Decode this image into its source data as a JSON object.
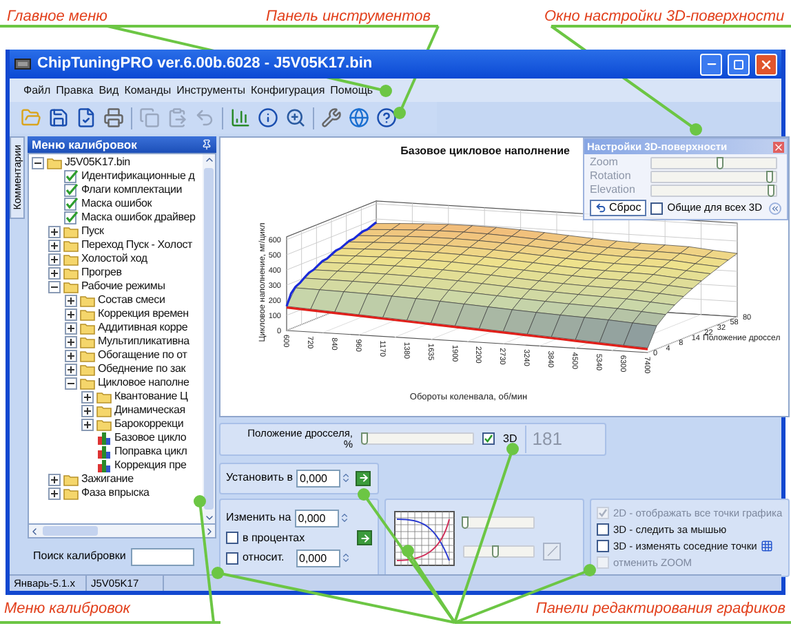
{
  "annotations": {
    "top": [
      {
        "text": "Главное меню"
      },
      {
        "text": "Панель инструментов"
      },
      {
        "text": "Окно настройки 3D-поверхности"
      }
    ],
    "bottom": [
      {
        "text": "Меню калибровок"
      },
      {
        "text": "Панели редактирования графиков"
      }
    ]
  },
  "window": {
    "title": "ChipTuningPRO ver.6.00b.6028 - J5V05K17.bin"
  },
  "menu": [
    "Файл",
    "Правка",
    "Вид",
    "Команды",
    "Инструменты",
    "Конфигурация",
    "Помощь"
  ],
  "side_tab": "Комментарии",
  "calibration_menu": {
    "title": "Меню калибровок",
    "tree": [
      {
        "label": "J5V05K17.bin",
        "kind": "folder",
        "expanded": true,
        "children": [
          {
            "label": "Идентификационные д",
            "kind": "check"
          },
          {
            "label": "Флаги комплектации",
            "kind": "check"
          },
          {
            "label": "Маска ошибок",
            "kind": "check"
          },
          {
            "label": "Маска ошибок драйвер",
            "kind": "check"
          },
          {
            "label": "Пуск",
            "kind": "folder",
            "expanded": false
          },
          {
            "label": "Переход Пуск - Холост",
            "kind": "folder",
            "expanded": false
          },
          {
            "label": "Холостой ход",
            "kind": "folder",
            "expanded": false
          },
          {
            "label": "Прогрев",
            "kind": "folder",
            "expanded": false
          },
          {
            "label": "Рабочие режимы",
            "kind": "folder",
            "expanded": true,
            "children": [
              {
                "label": "Состав смеси",
                "kind": "folder",
                "expanded": false
              },
              {
                "label": "Коррекция времен",
                "kind": "folder",
                "expanded": false
              },
              {
                "label": "Аддитивная корре",
                "kind": "folder",
                "expanded": false
              },
              {
                "label": "Мультипликативна",
                "kind": "folder",
                "expanded": false
              },
              {
                "label": "Обогащение по от",
                "kind": "folder",
                "expanded": false
              },
              {
                "label": "Обеднение по зак",
                "kind": "folder",
                "expanded": false
              },
              {
                "label": "Цикловое наполне",
                "kind": "folder",
                "expanded": true,
                "children": [
                  {
                    "label": "Квантование Ц",
                    "kind": "folder",
                    "expanded": false
                  },
                  {
                    "label": "Динамическая",
                    "kind": "folder",
                    "expanded": false
                  },
                  {
                    "label": "Барокоррекци",
                    "kind": "folder",
                    "expanded": false
                  },
                  {
                    "label": "Базовое цикло",
                    "kind": "chart"
                  },
                  {
                    "label": "Поправка цикл",
                    "kind": "chart"
                  },
                  {
                    "label": "Коррекция пре",
                    "kind": "chart"
                  }
                ]
              }
            ]
          },
          {
            "label": "Зажигание",
            "kind": "folder",
            "expanded": false
          },
          {
            "label": "Фаза впрыска",
            "kind": "folder",
            "expanded": false
          }
        ]
      }
    ],
    "search_label": "Поиск калибровки"
  },
  "chart": {
    "title": "Базовое цикловое наполнение",
    "ylabel": "Цикловое наполнение, мг/цикл",
    "xlabel": "Обороты коленвала, об/мин",
    "zlabel": "Положение дроссел",
    "y_tick_labels": [
      "600",
      "500",
      "400",
      "300",
      "200",
      "100",
      "0"
    ],
    "x_tick_labels": [
      "600",
      "720",
      "840",
      "960",
      "1170",
      "1380",
      "1635",
      "1900",
      "2200",
      "2730",
      "3240",
      "3840",
      "4500",
      "5340",
      "6300",
      "7400"
    ],
    "z_tick_labels": [
      "0",
      "4",
      "8",
      "14",
      "22",
      "32",
      "58",
      "80"
    ]
  },
  "settings_3d": {
    "title": "Настройки 3D-поверхности",
    "sliders": [
      {
        "label": "Zoom",
        "level": 0.55
      },
      {
        "label": "Rotation",
        "level": 0.95
      },
      {
        "label": "Elevation",
        "level": 0.97
      }
    ],
    "reset_button": "Сброс",
    "common_checkbox": {
      "label": "Общие для всех 3D",
      "checked": false
    }
  },
  "throttle_panel": {
    "label_line_1": "Положение дросселя,",
    "label_line_2": "%",
    "level": 0.02,
    "checkbox": {
      "label": "3D",
      "checked": true
    },
    "value": "181"
  },
  "set_panel": {
    "label": "Установить в",
    "value": "0,000"
  },
  "change_panel": {
    "label": "Изменить на",
    "value": "0,000",
    "percent": {
      "label": "в процентах",
      "checked": false
    },
    "relative": {
      "label": "относит.",
      "checked": false,
      "value": "0,000"
    }
  },
  "curve_panel": {
    "sliders": [
      {
        "level": 0.02
      },
      {
        "level": 0.45
      }
    ]
  },
  "options_panel": {
    "options": [
      {
        "label": "2D - отображать все точки графика",
        "checked": true,
        "disabled": true
      },
      {
        "label": "3D - следить за мышью",
        "checked": false,
        "disabled": false
      },
      {
        "label": "3D - изменять соседние точки",
        "checked": false,
        "disabled": false
      },
      {
        "label": "отменить ZOOM",
        "checked": false,
        "disabled": true
      }
    ]
  },
  "status_bar": [
    "Январь-5.1.x",
    "J5V05K17"
  ]
}
